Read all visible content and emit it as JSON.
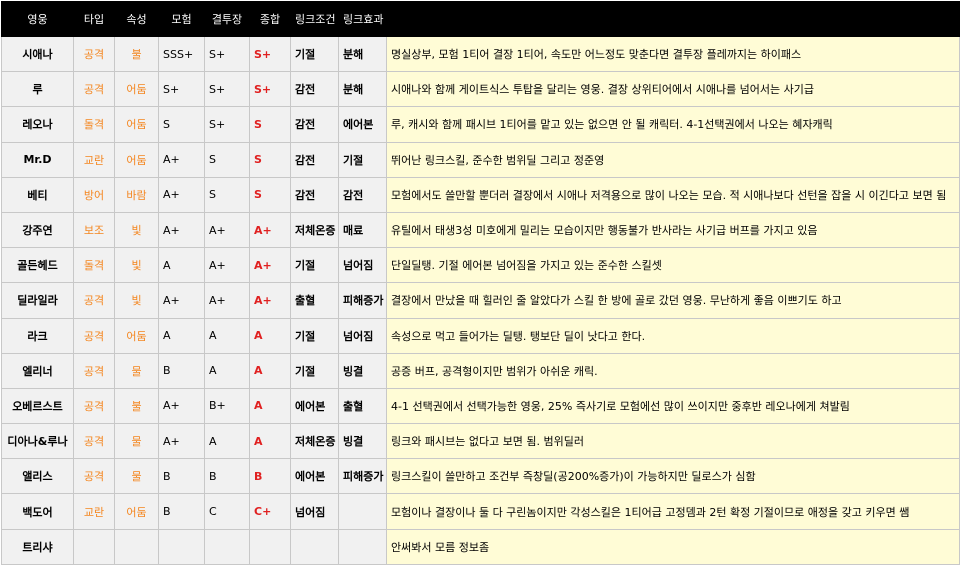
{
  "headers": [
    "영웅",
    "타입",
    "속성",
    "모험",
    "결투장",
    "종합",
    "링크조건",
    "링크효과",
    ""
  ],
  "rows": [
    {
      "hero": "시애나",
      "type": "공격",
      "attr": "불",
      "adv": "SSS+",
      "duel": "S+",
      "total": "S+",
      "cond": "기절",
      "effect": "분해",
      "desc": "명실상부, 모험 1티어 결장 1티어, 속도만 어느정도 맞춘다면 결투장 플레까지는 하이패스"
    },
    {
      "hero": "루",
      "type": "공격",
      "attr": "어둠",
      "adv": "S+",
      "duel": "S+",
      "total": "S+",
      "cond": "감전",
      "effect": "분해",
      "desc": "시애나와 함께 게이트식스 투탑을 달리는 영웅. 결장 상위티어에서 시애나를 넘어서는 사기급"
    },
    {
      "hero": "레오나",
      "type": "돌격",
      "attr": "어둠",
      "adv": "S",
      "duel": "S+",
      "total": "S",
      "cond": "감전",
      "effect": "에어본",
      "desc": "루, 캐시와 함께 패시브 1티어를 맡고 있는 없으면 안 될 캐릭터. 4-1선택권에서 나오는 혜자캐릭"
    },
    {
      "hero": "Mr.D",
      "type": "교란",
      "attr": "어둠",
      "adv": "A+",
      "duel": "S",
      "total": "S",
      "cond": "감전",
      "effect": "기절",
      "desc": "뛰어난 링크스킬, 준수한 범위딜 그리고 정준영"
    },
    {
      "hero": "베티",
      "type": "방어",
      "attr": "바람",
      "adv": "A+",
      "duel": "S",
      "total": "S",
      "cond": "감전",
      "effect": "감전",
      "desc": "모험에서도 쓸만할 뿐더러 결장에서 시애나 저격용으로 많이 나오는 모습. 적 시애나보다 선턴을 잡을 시 이긴다고 보면 됨"
    },
    {
      "hero": "강주연",
      "type": "보조",
      "attr": "빛",
      "adv": "A+",
      "duel": "A+",
      "total": "A+",
      "cond": "저체온증",
      "effect": "매료",
      "desc": "유틸에서 태생3성 미호에게 밀리는 모습이지만 행동불가 반사라는 사기급 버프를 가지고 있음"
    },
    {
      "hero": "골든헤드",
      "type": "돌격",
      "attr": "빛",
      "adv": "A",
      "duel": "A+",
      "total": "A+",
      "cond": "기절",
      "effect": "넘어짐",
      "desc": "단일딜탱.  기절 에어본 넘어짐을 가지고 있는 준수한 스킬셋"
    },
    {
      "hero": "딜라일라",
      "type": "공격",
      "attr": "빛",
      "adv": "A+",
      "duel": "A+",
      "total": "A+",
      "cond": "출혈",
      "effect": "피해증가",
      "desc": "결장에서 만났을 때 힐러인 줄 알았다가 스킬 한 방에 골로 갔던 영웅. 무난하게 좋음 이쁘기도 하고"
    },
    {
      "hero": "라크",
      "type": "공격",
      "attr": "어둠",
      "adv": "A",
      "duel": "A",
      "total": "A",
      "cond": "기절",
      "effect": "넘어짐",
      "desc": "속성으로 먹고 들어가는 딜탱. 탱보단 딜이 낫다고 한다."
    },
    {
      "hero": "엘리너",
      "type": "공격",
      "attr": "물",
      "adv": "B",
      "duel": "A",
      "total": "A",
      "cond": "기절",
      "effect": "빙결",
      "desc": "공증 버프, 공격형이지만 범위가 아쉬운 캐릭."
    },
    {
      "hero": "오베르스트",
      "type": "공격",
      "attr": "불",
      "adv": "A+",
      "duel": "B+",
      "total": "A",
      "cond": "에어본",
      "effect": "출혈",
      "desc": "4-1 선택권에서 선택가능한 영웅, 25% 즉사기로 모험에선 많이 쓰이지만 중후반 레오나에게 쳐발림"
    },
    {
      "hero": "디아나&루나",
      "type": "공격",
      "attr": "물",
      "adv": "A+",
      "duel": "A",
      "total": "A",
      "cond": "저체온증",
      "effect": "빙결",
      "desc": "링크와 패시브는 없다고 보면 됨. 범위딜러"
    },
    {
      "hero": "앨리스",
      "type": "공격",
      "attr": "물",
      "adv": "B",
      "duel": "B",
      "total": "B",
      "cond": "에어본",
      "effect": "피해증가",
      "desc": "링크스킬이 쓸만하고 조건부 즉창딜(공200%증가)이 가능하지만 딜로스가 심함"
    },
    {
      "hero": "백도어",
      "type": "교란",
      "attr": "어둠",
      "adv": "B",
      "duel": "C",
      "total": "C+",
      "cond": "넘어짐",
      "effect": "",
      "desc": "모험이나 결장이나 둘 다 구린놈이지만 각성스킬은 1티어급 고정뎀과 2턴 확정 기절이므로 애정을 갖고 키우면 쌤"
    },
    {
      "hero": "트리샤",
      "type": "",
      "attr": "",
      "adv": "",
      "duel": "",
      "total": "",
      "cond": "",
      "effect": "",
      "desc": "안써봐서 모름 정보좀"
    }
  ]
}
